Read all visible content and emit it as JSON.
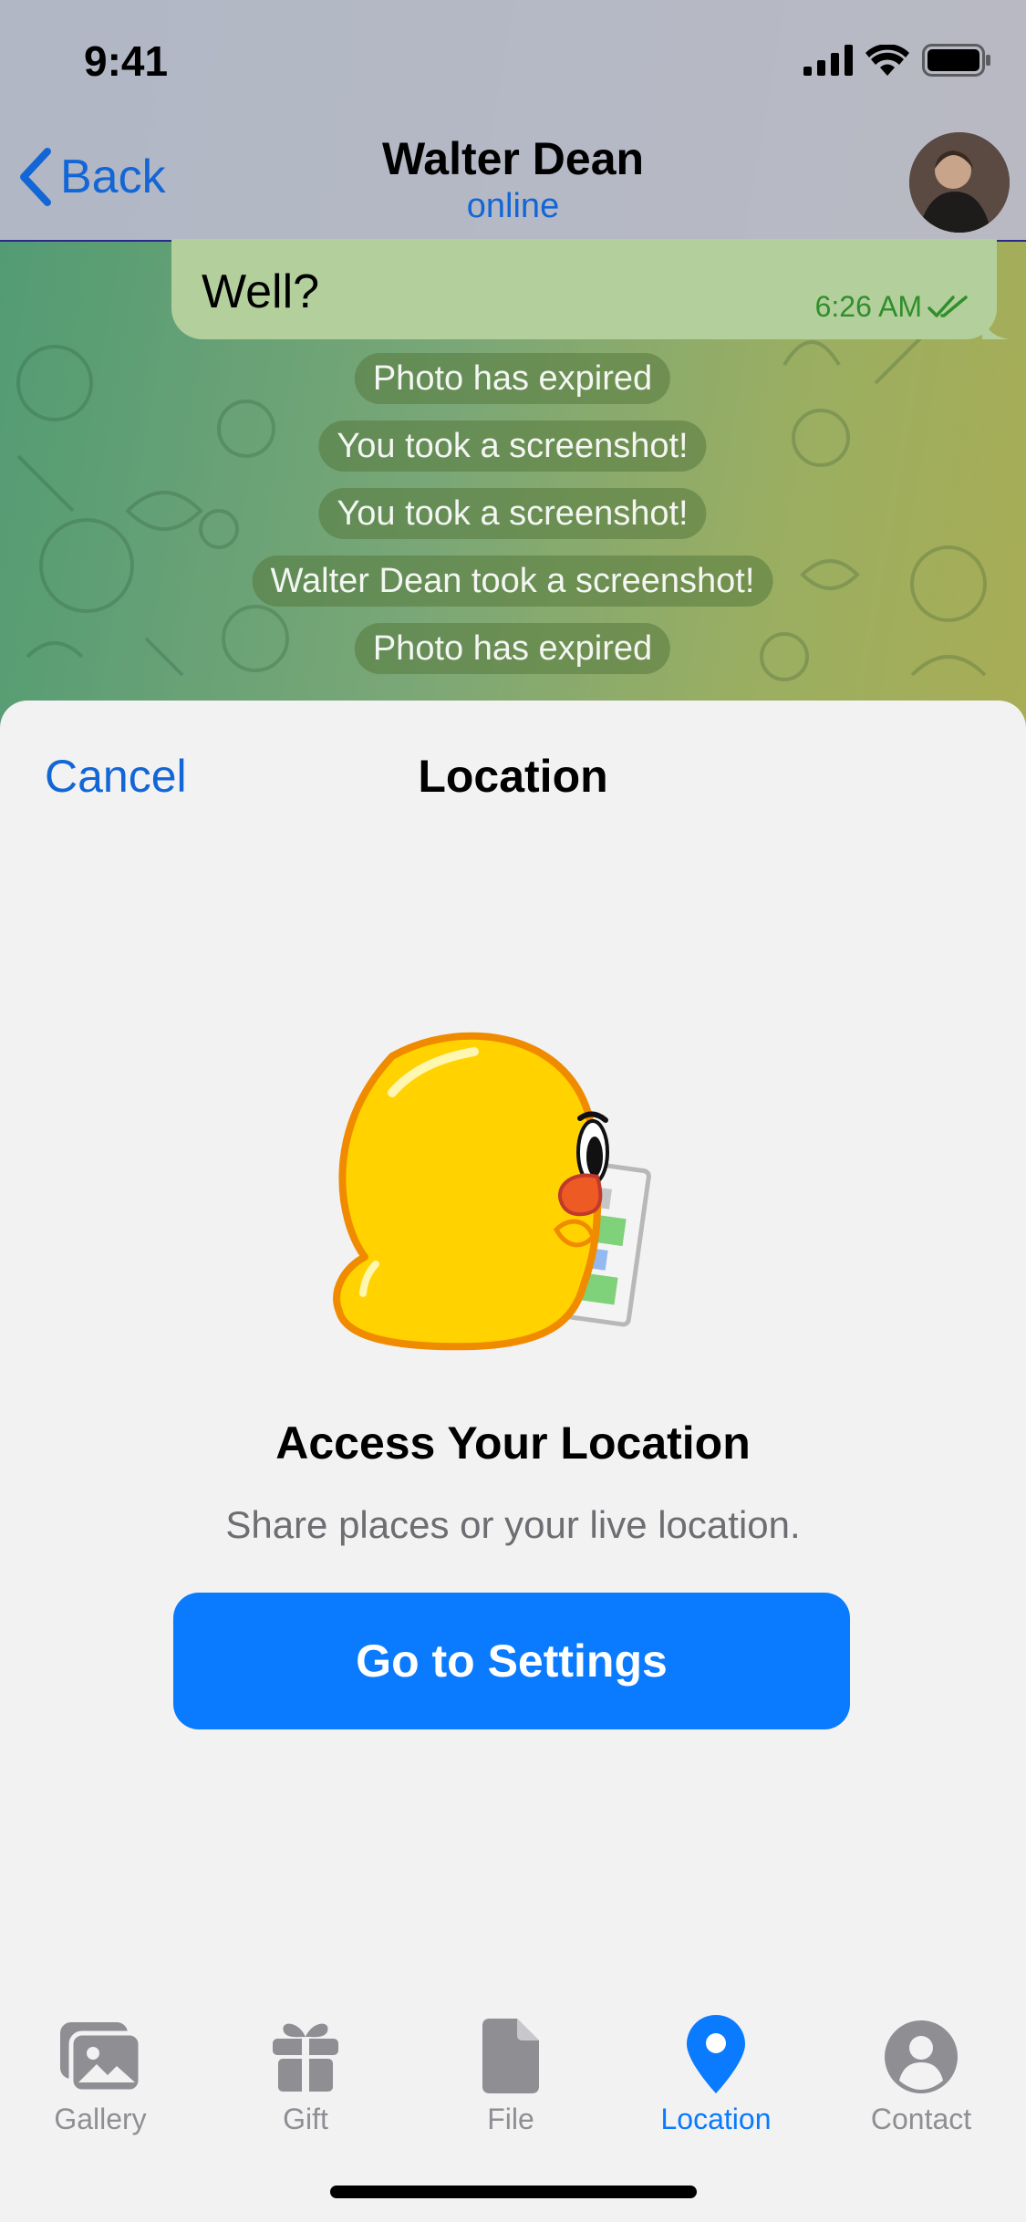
{
  "status_bar": {
    "time": "9:41",
    "icons": [
      "signal-icon",
      "wifi-icon",
      "battery-icon"
    ]
  },
  "header": {
    "back_label": "Back",
    "title": "Walter Dean",
    "subtitle": "online"
  },
  "messages": {
    "outgoing": {
      "text": "Well?",
      "time": "6:26 AM",
      "status": "read"
    },
    "service": [
      "Photo has expired",
      "You took a screenshot!",
      "You took a screenshot!",
      "Walter Dean took a screenshot!",
      "Photo has expired"
    ]
  },
  "sheet": {
    "cancel_label": "Cancel",
    "title": "Location",
    "access_title": "Access Your Location",
    "access_subtitle": "Share places or your live location.",
    "settings_button": "Go to Settings"
  },
  "tabbar": {
    "items": [
      {
        "label": "Gallery",
        "icon": "gallery-icon",
        "active": false
      },
      {
        "label": "Gift",
        "icon": "gift-icon",
        "active": false
      },
      {
        "label": "File",
        "icon": "file-icon",
        "active": false
      },
      {
        "label": "Location",
        "icon": "location-pin-icon",
        "active": true
      },
      {
        "label": "Contact",
        "icon": "contact-icon",
        "active": false
      }
    ]
  },
  "colors": {
    "accent": "#0a7aff",
    "link": "#1366d6",
    "bubble": "#b3cf9c",
    "inactive_tab": "#8e8e93"
  }
}
